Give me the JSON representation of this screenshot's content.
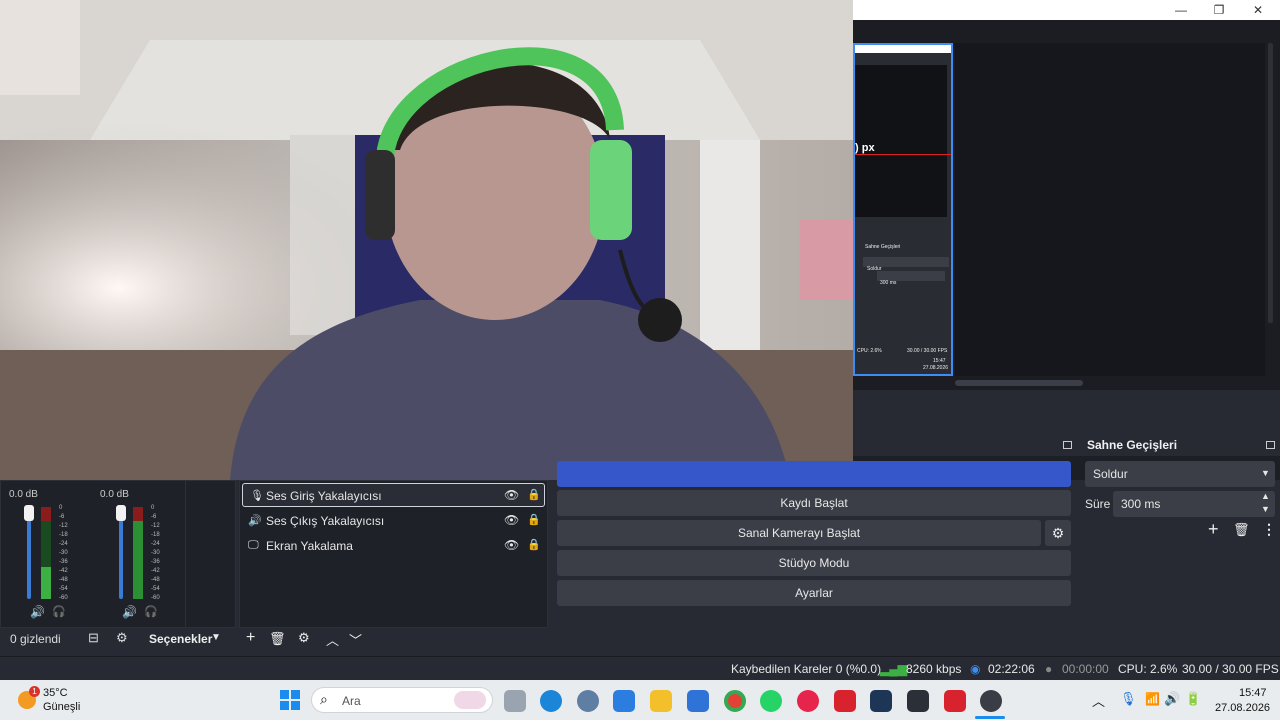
{
  "preview": {
    "px_label": ") px",
    "mini_transitions_title": "Sahne Geçişleri",
    "mini_transition_value": "Soldur",
    "mini_duration_value": "300 ms",
    "mini_stats": "CPU: 2.6%",
    "mini_fps": "30.00 / 30.00 FPS",
    "mini_time": "15:47",
    "mini_date": "27.08.2026"
  },
  "audio_mixer": {
    "channels": [
      {
        "db": "0.0 dB"
      },
      {
        "db": "0.0 dB"
      }
    ],
    "tick_labels": [
      "0",
      "-6",
      "-12",
      "-18",
      "-24",
      "-30",
      "-36",
      "-42",
      "-48",
      "-54",
      "-60"
    ],
    "hidden_label": "0 gizlendi",
    "options_label": "Seçenekler"
  },
  "sources": {
    "items": [
      {
        "label": "Ses Giriş Yakalayıcısı",
        "icon": "microphone-icon"
      },
      {
        "label": "Ses Çıkış Yakalayıcısı",
        "icon": "speaker-icon"
      },
      {
        "label": "Ekran Yakalama",
        "icon": "monitor-icon"
      }
    ]
  },
  "controls": {
    "start_recording": "Kaydı Başlat",
    "start_virtual_camera": "Sanal Kamerayı Başlat",
    "studio_mode": "Stüdyo Modu",
    "settings": "Ayarlar"
  },
  "transitions": {
    "title": "Sahne Geçişleri",
    "selected": "Soldur",
    "duration_label": "Süre",
    "duration_value": "300 ms"
  },
  "status": {
    "dropped_frames": "Kaybedilen Kareler 0 (%0.0)",
    "bitrate": "8260 kbps",
    "stream_time": "02:22:06",
    "record_time": "00:00:00",
    "cpu": "CPU: 2.6%",
    "fps": "30.00 / 30.00 FPS"
  },
  "taskbar": {
    "weather_temp": "35°C",
    "weather_desc": "Güneşli",
    "weather_badge": "1",
    "search_placeholder": "Ara",
    "time": "15:47",
    "date": "27.08.2026"
  },
  "colors": {
    "accent_blue": "#3557c9",
    "meter_green": "#3cb043",
    "meter_red": "#8b1c1c"
  }
}
